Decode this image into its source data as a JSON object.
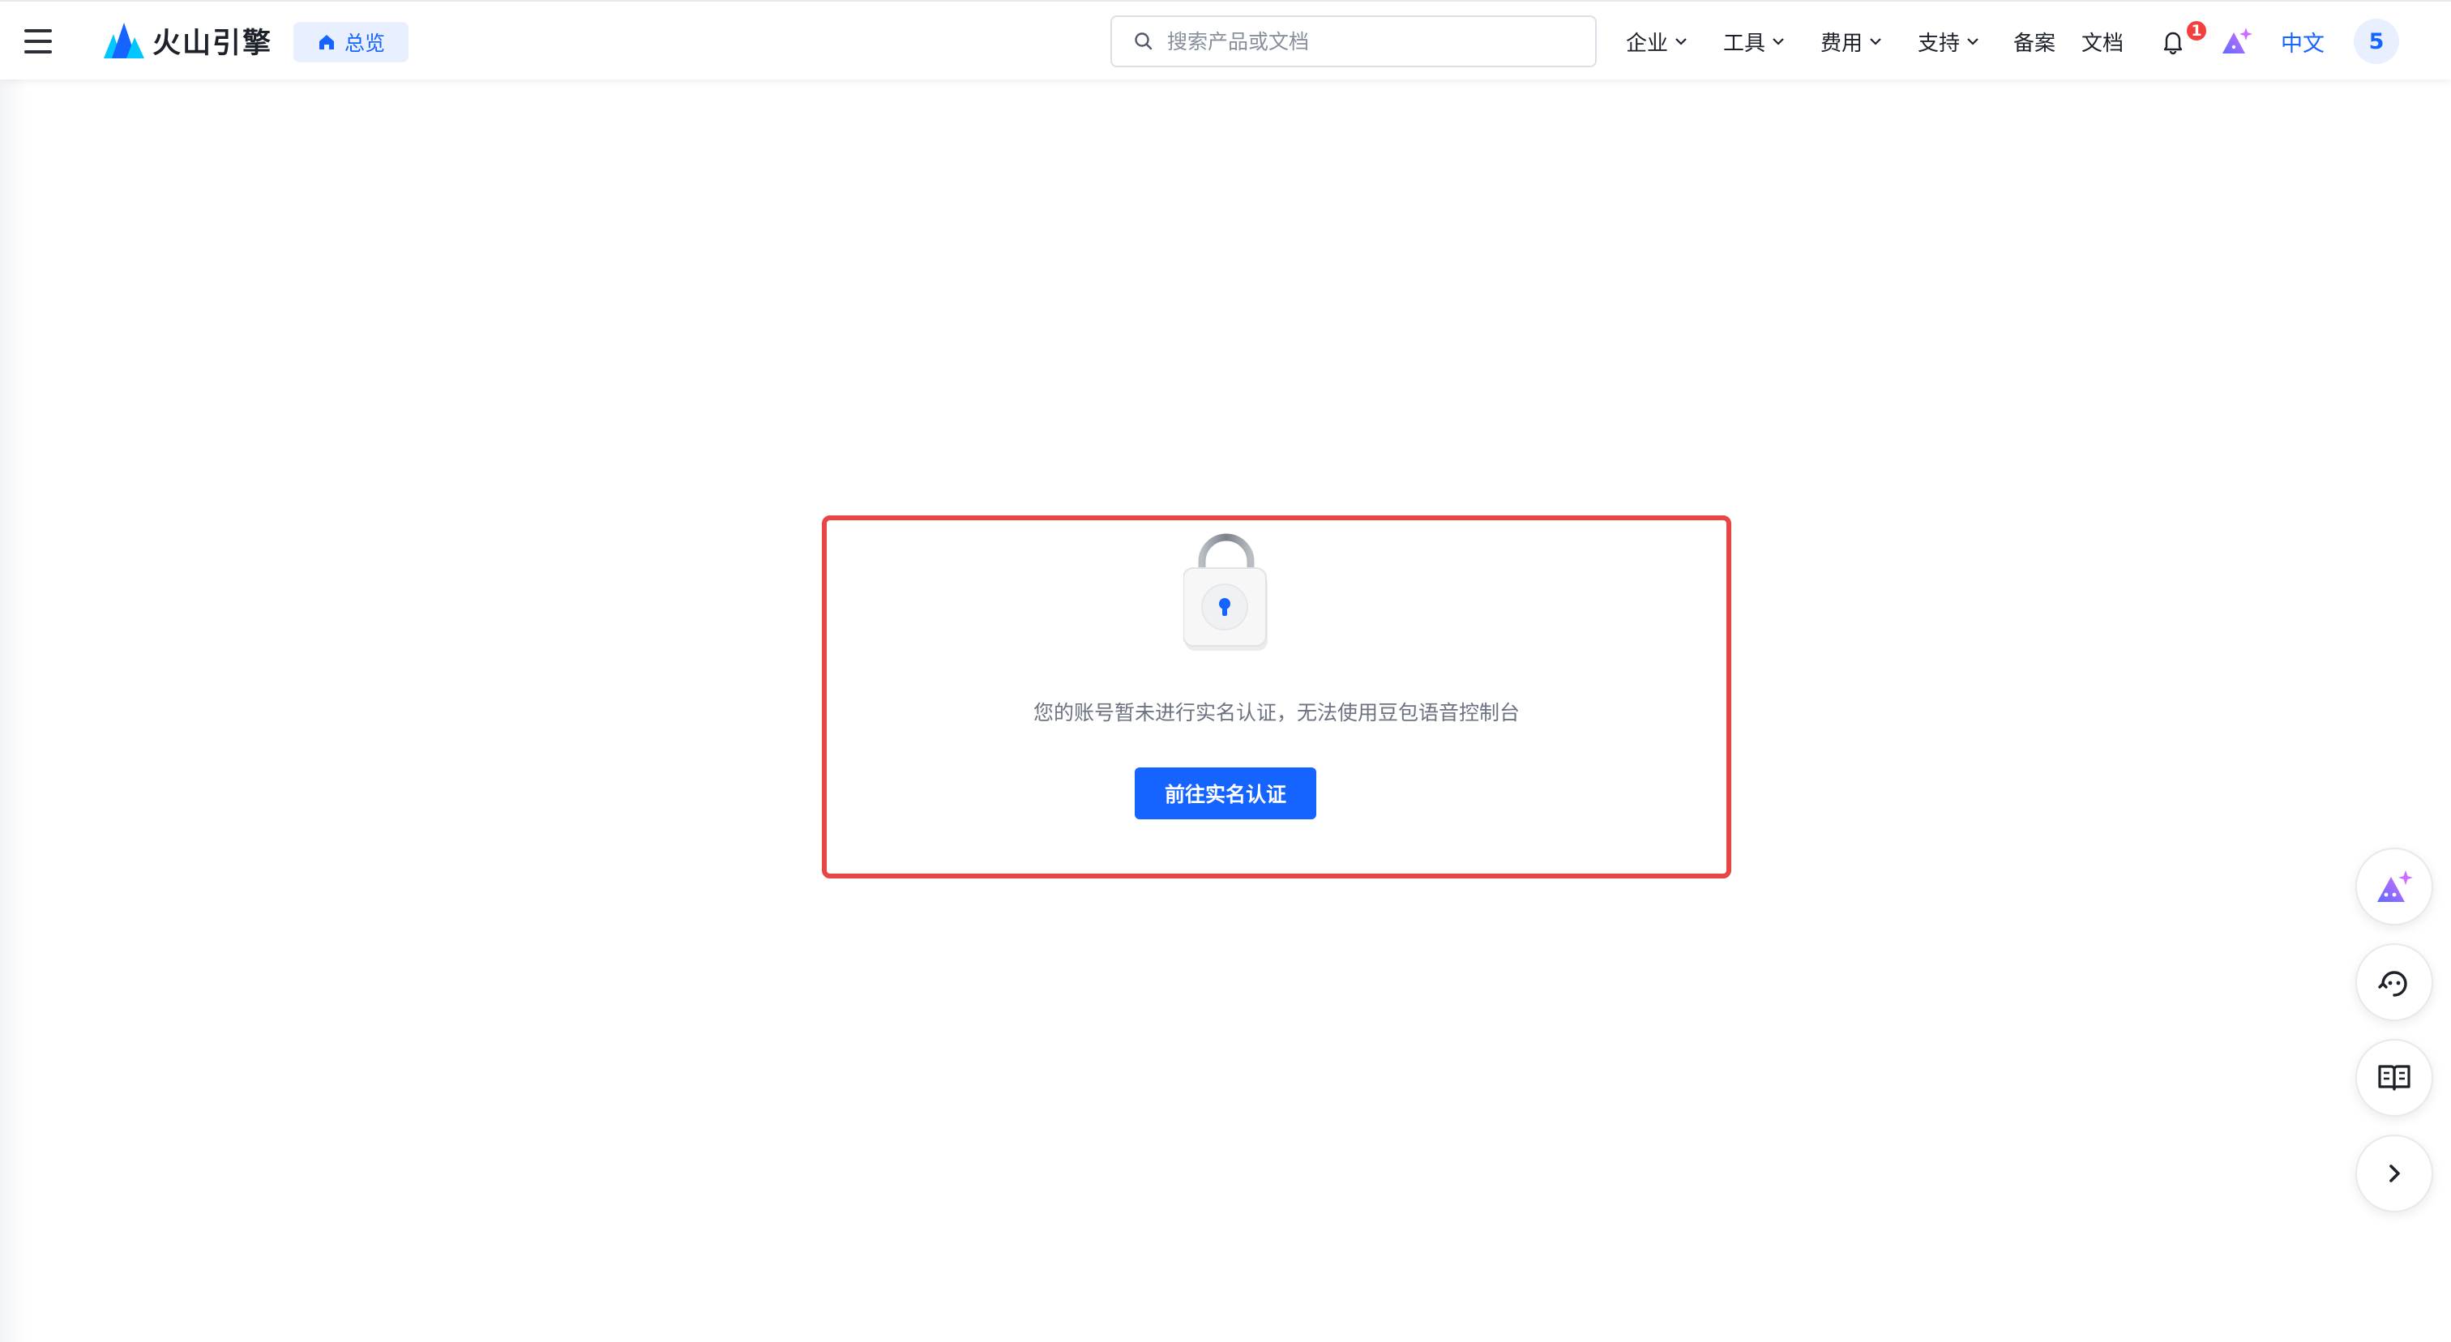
{
  "header": {
    "menu_icon": "hamburger-menu-icon",
    "logo_text": "火山引擎",
    "overview_label": "总览",
    "search_placeholder": "搜索产品或文档",
    "nav": [
      {
        "label": "企业",
        "has_dropdown": true
      },
      {
        "label": "工具",
        "has_dropdown": true
      },
      {
        "label": "费用",
        "has_dropdown": true
      },
      {
        "label": "支持",
        "has_dropdown": true
      },
      {
        "label": "备案",
        "has_dropdown": false
      },
      {
        "label": "文档",
        "has_dropdown": false
      }
    ],
    "notification_count": "1",
    "language": "中文",
    "avatar_label": "5"
  },
  "main": {
    "lock_message": "您的账号暂未进行实名认证，无法使用豆包语音控制台",
    "verify_button": "前往实名认证"
  },
  "floating_tools": [
    {
      "icon": "ai-assistant-icon"
    },
    {
      "icon": "customer-service-icon"
    },
    {
      "icon": "documentation-book-icon"
    },
    {
      "icon": "chevron-right-icon"
    }
  ],
  "colors": {
    "primary": "#1664ff",
    "highlight_border": "#e84545",
    "badge": "#f53f3f",
    "ai_gradient_start": "#5b6cff",
    "ai_gradient_end": "#d16bff"
  }
}
